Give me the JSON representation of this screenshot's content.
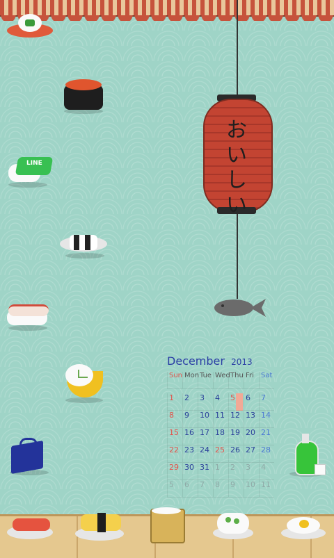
{
  "lantern": {
    "text_lines": [
      "お",
      "い",
      "し",
      "い"
    ]
  },
  "calendar": {
    "month": "December",
    "year": "2013",
    "weekdays": [
      "Sun",
      "Mon",
      "Tue",
      "Wed",
      "Thu",
      "Fri",
      "Sat"
    ],
    "weeks": [
      [
        "1",
        "2",
        "3",
        "4",
        "5",
        "6",
        "7"
      ],
      [
        "8",
        "9",
        "10",
        "11",
        "12",
        "13",
        "14"
      ],
      [
        "15",
        "16",
        "17",
        "18",
        "19",
        "20",
        "21"
      ],
      [
        "22",
        "23",
        "24",
        "25",
        "26",
        "27",
        "28"
      ],
      [
        "29",
        "30",
        "31",
        "1",
        "2",
        "3",
        "4"
      ],
      [
        "5",
        "6",
        "7",
        "8",
        "9",
        "10",
        "11"
      ]
    ],
    "today": "5"
  },
  "apps": {
    "line_label": "LINE"
  },
  "colors": {
    "background": "#9fd4c7",
    "lantern": "#c34432",
    "calendar_text": "#2b3fa5",
    "sunday": "#e2524a",
    "saturday": "#4b79d3"
  }
}
